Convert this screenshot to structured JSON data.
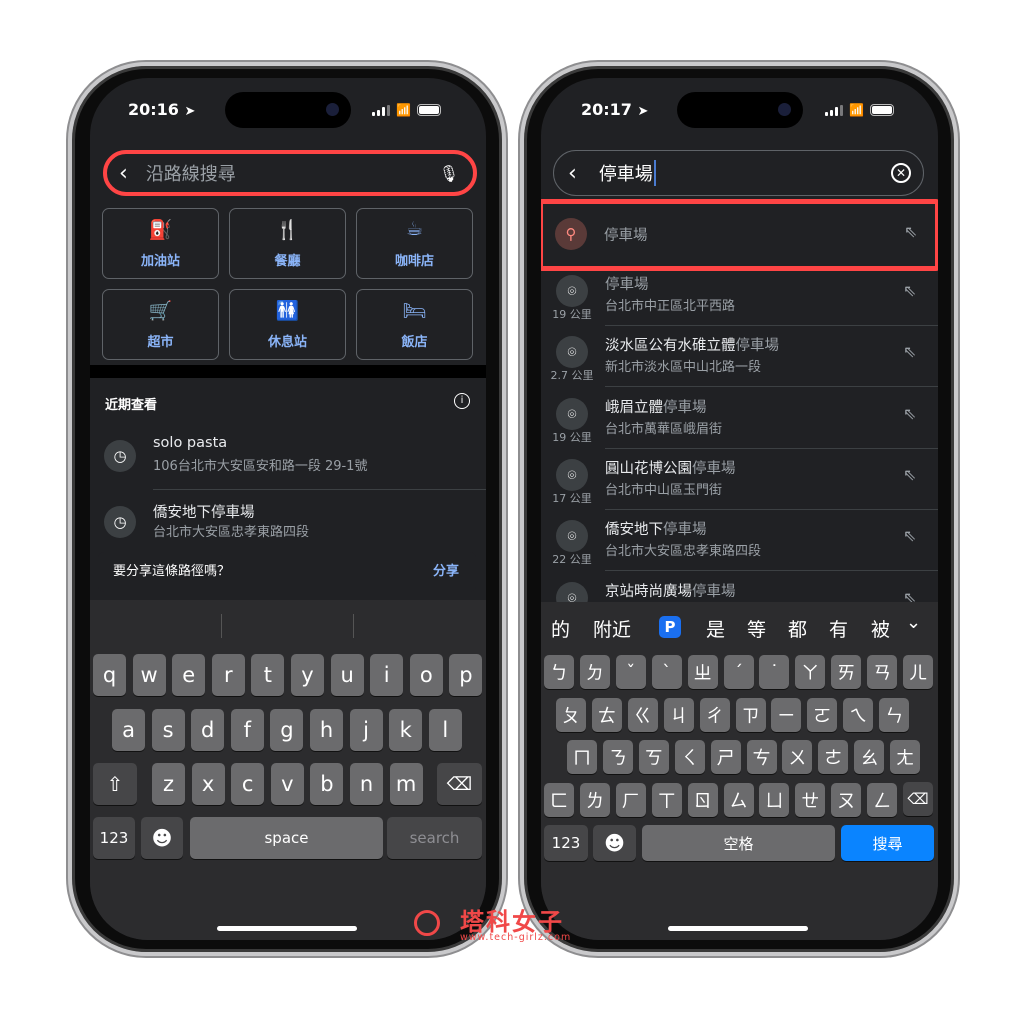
{
  "left": {
    "status": {
      "time": "20:16"
    },
    "search": {
      "placeholder": "沿路線搜尋"
    },
    "categories": [
      {
        "label": "加油站",
        "icon": "gas-station-icon",
        "glyph": "⛽"
      },
      {
        "label": "餐廳",
        "icon": "restaurant-icon",
        "glyph": "🍴"
      },
      {
        "label": "咖啡店",
        "icon": "coffee-icon",
        "glyph": "☕"
      },
      {
        "label": "超市",
        "icon": "cart-icon",
        "glyph": "🛒"
      },
      {
        "label": "休息站",
        "icon": "restroom-icon",
        "glyph": "🚻"
      },
      {
        "label": "飯店",
        "icon": "hotel-icon",
        "glyph": "🛏"
      }
    ],
    "recent": {
      "title": "近期查看",
      "items": [
        {
          "title": "solo pasta",
          "subtitle": "106台北市大安區安和路一段 29-1號"
        },
        {
          "title": "僑安地下停車場",
          "subtitle": "台北市大安區忠孝東路四段"
        }
      ]
    },
    "share": {
      "prompt": "要分享這條路徑嗎？",
      "action": "分享"
    },
    "keyboard": {
      "rows": [
        [
          "q",
          "w",
          "e",
          "r",
          "t",
          "y",
          "u",
          "i",
          "o",
          "p"
        ],
        [
          "a",
          "s",
          "d",
          "f",
          "g",
          "h",
          "j",
          "k",
          "l"
        ],
        [
          "z",
          "x",
          "c",
          "v",
          "b",
          "n",
          "m"
        ]
      ],
      "numbers": "123",
      "space": "space",
      "action": "search"
    }
  },
  "right": {
    "status": {
      "time": "20:17"
    },
    "search": {
      "value": "停車場"
    },
    "top_suggestion": "停車場",
    "results": [
      {
        "title_prefix": "",
        "title_match": "停車場",
        "subtitle": "台北市中正區北平西路",
        "distance": "19 公里"
      },
      {
        "title_prefix": "淡水區公有水碓立體",
        "title_match": "停車場",
        "subtitle": "新北市淡水區中山北路一段",
        "distance": "2.7 公里"
      },
      {
        "title_prefix": "峨眉立體",
        "title_match": "停車場",
        "subtitle": "台北市萬華區峨眉街",
        "distance": "19 公里"
      },
      {
        "title_prefix": "圓山花博公園",
        "title_match": "停車場",
        "subtitle": "台北市中山區玉門街",
        "distance": "17 公里"
      },
      {
        "title_prefix": "僑安地下",
        "title_match": "停車場",
        "subtitle": "台北市大安區忠孝東路四段",
        "distance": "22 公里"
      },
      {
        "title_prefix": "京站時尚廣場",
        "title_match": "停車場",
        "subtitle": "",
        "distance": ""
      }
    ],
    "keyboard": {
      "suggestions": [
        "的",
        "附近",
        "P",
        "是",
        "等",
        "都",
        "有",
        "被"
      ],
      "rows": [
        [
          "ㄅ",
          "ㄉ",
          "ˇ",
          "ˋ",
          "ㄓ",
          "ˊ",
          "˙",
          "ㄚ",
          "ㄞ",
          "ㄢ",
          "ㄦ"
        ],
        [
          "ㄆ",
          "ㄊ",
          "ㄍ",
          "ㄐ",
          "ㄔ",
          "ㄗ",
          "ㄧ",
          "ㄛ",
          "ㄟ",
          "ㄣ"
        ],
        [
          "ㄇ",
          "ㄋ",
          "ㄎ",
          "ㄑ",
          "ㄕ",
          "ㄘ",
          "ㄨ",
          "ㄜ",
          "ㄠ",
          "ㄤ"
        ],
        [
          "ㄈ",
          "ㄌ",
          "ㄏ",
          "ㄒ",
          "ㄖ",
          "ㄙ",
          "ㄩ",
          "ㄝ",
          "ㄡ",
          "ㄥ"
        ]
      ],
      "numbers": "123",
      "space": "空格",
      "action": "搜尋"
    }
  },
  "watermark": {
    "brand": "塔科女子",
    "url": "www.tech-girlz.com"
  },
  "colors": {
    "highlight": "#ff4545",
    "accent_blue": "#8ab4f8",
    "ios_blue": "#0a84ff",
    "screen_bg": "#202124"
  }
}
